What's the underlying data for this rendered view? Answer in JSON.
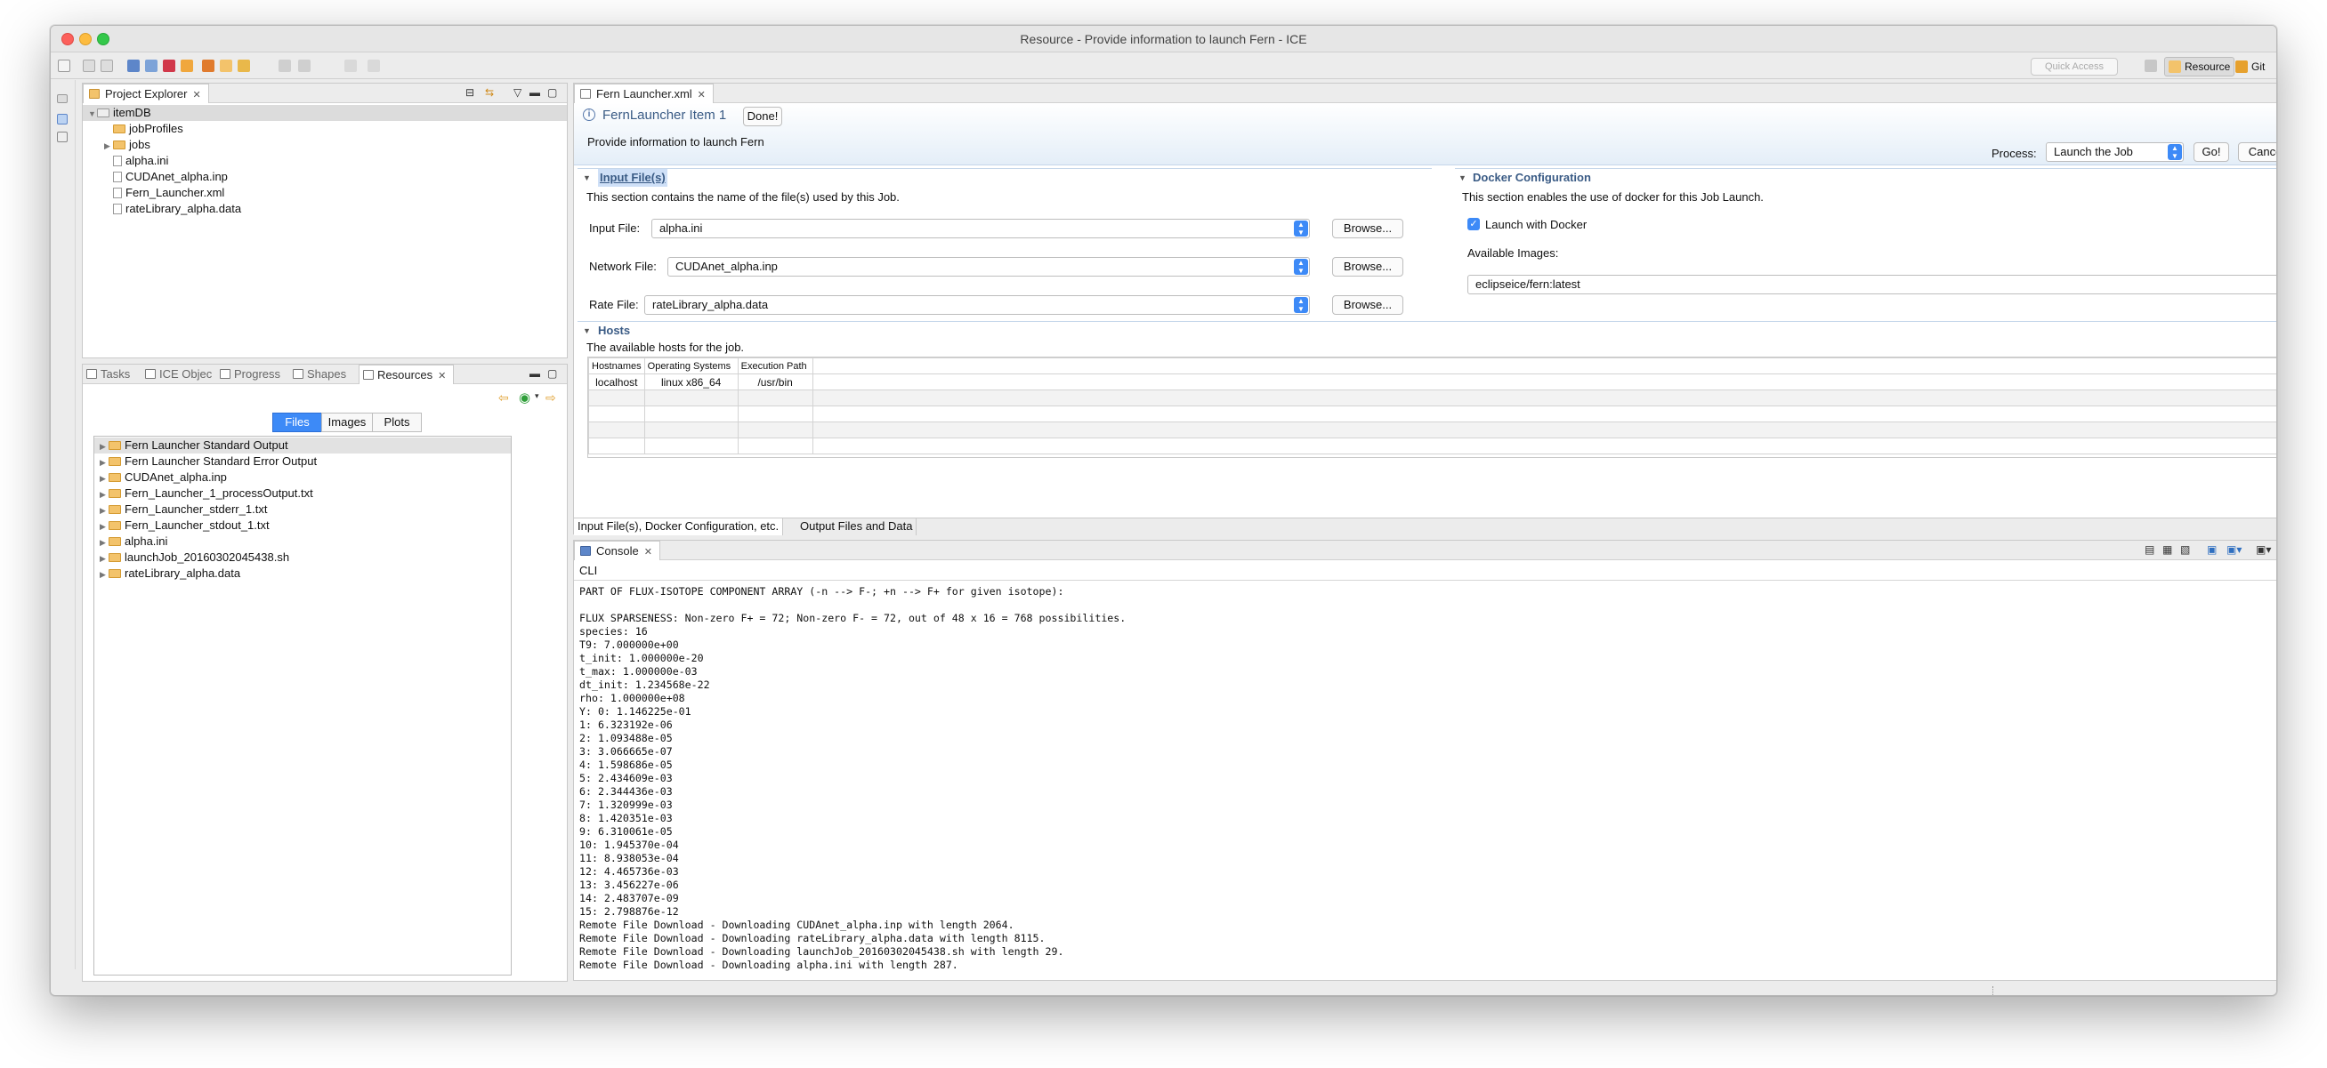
{
  "window": {
    "title": "Resource - Provide information to launch Fern - ICE"
  },
  "toolbar": {
    "quick_access": "Quick Access",
    "perspective_resource": "Resource",
    "perspective_git": "Git"
  },
  "project_explorer": {
    "title": "Project Explorer",
    "root": "itemDB",
    "items": [
      {
        "label": "jobProfiles",
        "kind": "folder",
        "expandable": false
      },
      {
        "label": "jobs",
        "kind": "folder",
        "expandable": true
      },
      {
        "label": "alpha.ini",
        "kind": "file"
      },
      {
        "label": "CUDAnet_alpha.inp",
        "kind": "file"
      },
      {
        "label": "Fern_Launcher.xml",
        "kind": "file"
      },
      {
        "label": "rateLibrary_alpha.data",
        "kind": "file"
      }
    ]
  },
  "bottom_left": {
    "tabs": [
      "Tasks",
      "ICE Objec",
      "Progress",
      "Shapes",
      "Resources"
    ],
    "active_tab": "Resources",
    "segments": [
      "Files",
      "Images",
      "Plots"
    ],
    "selected_segment": "Files",
    "files": [
      "Fern Launcher Standard Output",
      "Fern Launcher Standard Error Output",
      "CUDAnet_alpha.inp",
      "Fern_Launcher_1_processOutput.txt",
      "Fern_Launcher_stderr_1.txt",
      "Fern_Launcher_stdout_1.txt",
      "alpha.ini",
      "launchJob_20160302045438.sh",
      "rateLibrary_alpha.data"
    ]
  },
  "editor": {
    "tab": "Fern Launcher.xml",
    "item_title": "FernLauncher Item 1",
    "done_button": "Done!",
    "description": "Provide information to launch Fern",
    "process_label": "Process:",
    "process_value": "Launch the Job",
    "go_button": "Go!",
    "cancel_button": "Cancel",
    "input_section": {
      "title": "Input File(s)",
      "description": "This section contains the name of the file(s) used by this Job.",
      "fields": [
        {
          "label": "Input File:",
          "value": "alpha.ini",
          "button": "Browse..."
        },
        {
          "label": "Network File:",
          "value": "CUDAnet_alpha.inp",
          "button": "Browse..."
        },
        {
          "label": "Rate File:",
          "value": "rateLibrary_alpha.data",
          "button": "Browse..."
        }
      ]
    },
    "docker_section": {
      "title": "Docker Configuration",
      "description": "This section enables the use of docker for this Job Launch.",
      "checkbox_label": "Launch with Docker",
      "checked": true,
      "images_label": "Available Images:",
      "image_value": "eclipseice/fern:latest"
    },
    "hosts_section": {
      "title": "Hosts",
      "description": "The available hosts for the job.",
      "columns": [
        "Hostnames",
        "Operating Systems",
        "Execution Path"
      ],
      "rows": [
        [
          "localhost",
          "linux x86_64",
          "/usr/bin"
        ]
      ],
      "add_button": "+",
      "remove_button": "-"
    },
    "bottom_tabs": [
      "Input File(s), Docker Configuration, etc.",
      "Output Files and Data"
    ]
  },
  "console": {
    "tab": "Console",
    "subtitle": "CLI",
    "lines": [
      "PART OF FLUX-ISOTOPE COMPONENT ARRAY (-n --> F-; +n --> F+ for given isotope):",
      "",
      "FLUX SPARSENESS: Non-zero F+ = 72; Non-zero F- = 72, out of 48 x 16 = 768 possibilities.",
      "species: 16",
      "T9: 7.000000e+00",
      "t_init: 1.000000e-20",
      "t_max: 1.000000e-03",
      "dt_init: 1.234568e-22",
      "rho: 1.000000e+08",
      "Y: 0: 1.146225e-01",
      "1: 6.323192e-06",
      "2: 1.093488e-05",
      "3: 3.066665e-07",
      "4: 1.598686e-05",
      "5: 2.434609e-03",
      "6: 2.344436e-03",
      "7: 1.320999e-03",
      "8: 1.420351e-03",
      "9: 6.310061e-05",
      "10: 1.945370e-04",
      "11: 8.938053e-04",
      "12: 4.465736e-03",
      "13: 3.456227e-06",
      "14: 2.483707e-09",
      "15: 2.798876e-12",
      "Remote File Download - Downloading CUDAnet_alpha.inp with length 2064.",
      "Remote File Download - Downloading rateLibrary_alpha.data with length 8115.",
      "Remote File Download - Downloading launchJob_20160302045438.sh with length 29.",
      "Remote File Download - Downloading alpha.ini with length 287."
    ]
  },
  "colors": {
    "accent": "#3d8af7",
    "section_title": "#3a5b85",
    "header_band": "#e4eef8"
  }
}
